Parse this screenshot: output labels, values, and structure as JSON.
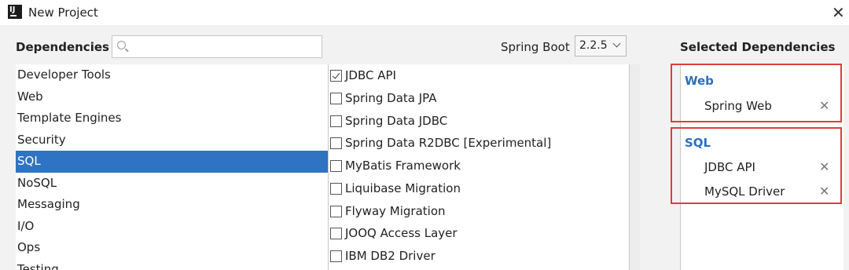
{
  "window": {
    "title": "New Project"
  },
  "dependencies_label": "Dependencies",
  "search": {
    "placeholder": ""
  },
  "spring_boot": {
    "label": "Spring Boot",
    "value": "2.2.5"
  },
  "selected_title": "Selected Dependencies",
  "categories": [
    "Developer Tools",
    "Web",
    "Template Engines",
    "Security",
    "SQL",
    "NoSQL",
    "Messaging",
    "I/O",
    "Ops",
    "Testing"
  ],
  "selected_category": "SQL",
  "sql_dependencies": [
    {
      "label": "JDBC API",
      "checked": true
    },
    {
      "label": "Spring Data JPA",
      "checked": false
    },
    {
      "label": "Spring Data JDBC",
      "checked": false
    },
    {
      "label": "Spring Data R2DBC [Experimental]",
      "checked": false
    },
    {
      "label": "MyBatis Framework",
      "checked": false
    },
    {
      "label": "Liquibase Migration",
      "checked": false
    },
    {
      "label": "Flyway Migration",
      "checked": false
    },
    {
      "label": "JOOQ Access Layer",
      "checked": false
    },
    {
      "label": "IBM DB2 Driver",
      "checked": false
    }
  ],
  "selected_groups": [
    {
      "name": "Web",
      "items": [
        "Spring Web"
      ]
    },
    {
      "name": "SQL",
      "items": [
        "JDBC API",
        "MySQL Driver"
      ]
    }
  ],
  "colors": {
    "selection": "#2f73c3",
    "group_title": "#2a6fbe",
    "highlight_box": "#e23b3b"
  },
  "icons": {
    "remove": "close-icon",
    "window_close": "close-icon",
    "search": "search-icon"
  }
}
